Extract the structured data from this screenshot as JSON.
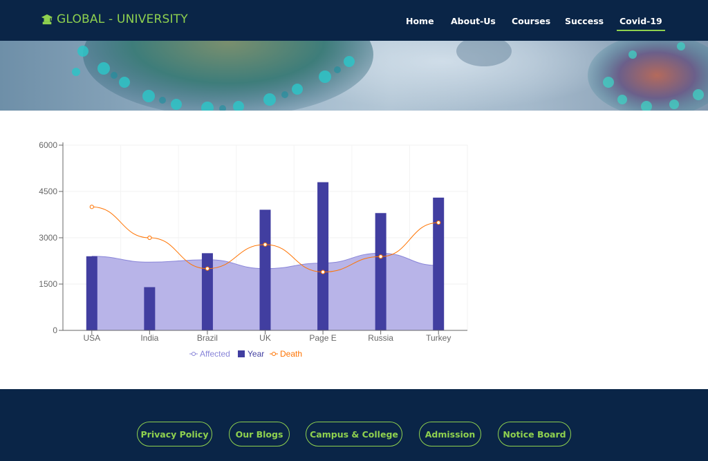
{
  "brand": {
    "text": "GLOBAL - UNIVERSITY",
    "icon": "graduation-cap-icon",
    "color": "#8fd14f"
  },
  "nav": {
    "items": [
      {
        "label": "Home",
        "active": false
      },
      {
        "label": "About-Us",
        "active": false
      },
      {
        "label": "Courses",
        "active": false
      },
      {
        "label": "Success",
        "active": false
      },
      {
        "label": "Covid-19",
        "active": true
      }
    ]
  },
  "chart_data": {
    "type": "bar",
    "categories": [
      "USA",
      "India",
      "Brazil",
      "UK",
      "Page E",
      "Russia",
      "Turkey"
    ],
    "series": [
      {
        "name": "Affected",
        "type": "area",
        "color": "#8884d8",
        "values": [
          2400,
          2210,
          2290,
          2000,
          2181,
          2500,
          2100
        ]
      },
      {
        "name": "Year",
        "type": "bar",
        "color": "#413ea0",
        "values": [
          2400,
          1400,
          2500,
          3908,
          4800,
          3800,
          4300
        ]
      },
      {
        "name": "Death",
        "type": "line",
        "color": "#ff7300",
        "values": [
          4000,
          3000,
          2000,
          2780,
          1890,
          2390,
          3490
        ]
      }
    ],
    "yticks": [
      "0",
      "1500",
      "3000",
      "4500",
      "6000"
    ],
    "ylim": [
      0,
      6000
    ],
    "grid": true,
    "legend": "bottom"
  },
  "footer": {
    "links": [
      "Privacy Policy",
      "Our Blogs",
      "Campus & College",
      "Admission",
      "Notice Board"
    ]
  },
  "colors": {
    "navy": "#0a2547",
    "accent": "#8fd14f"
  }
}
